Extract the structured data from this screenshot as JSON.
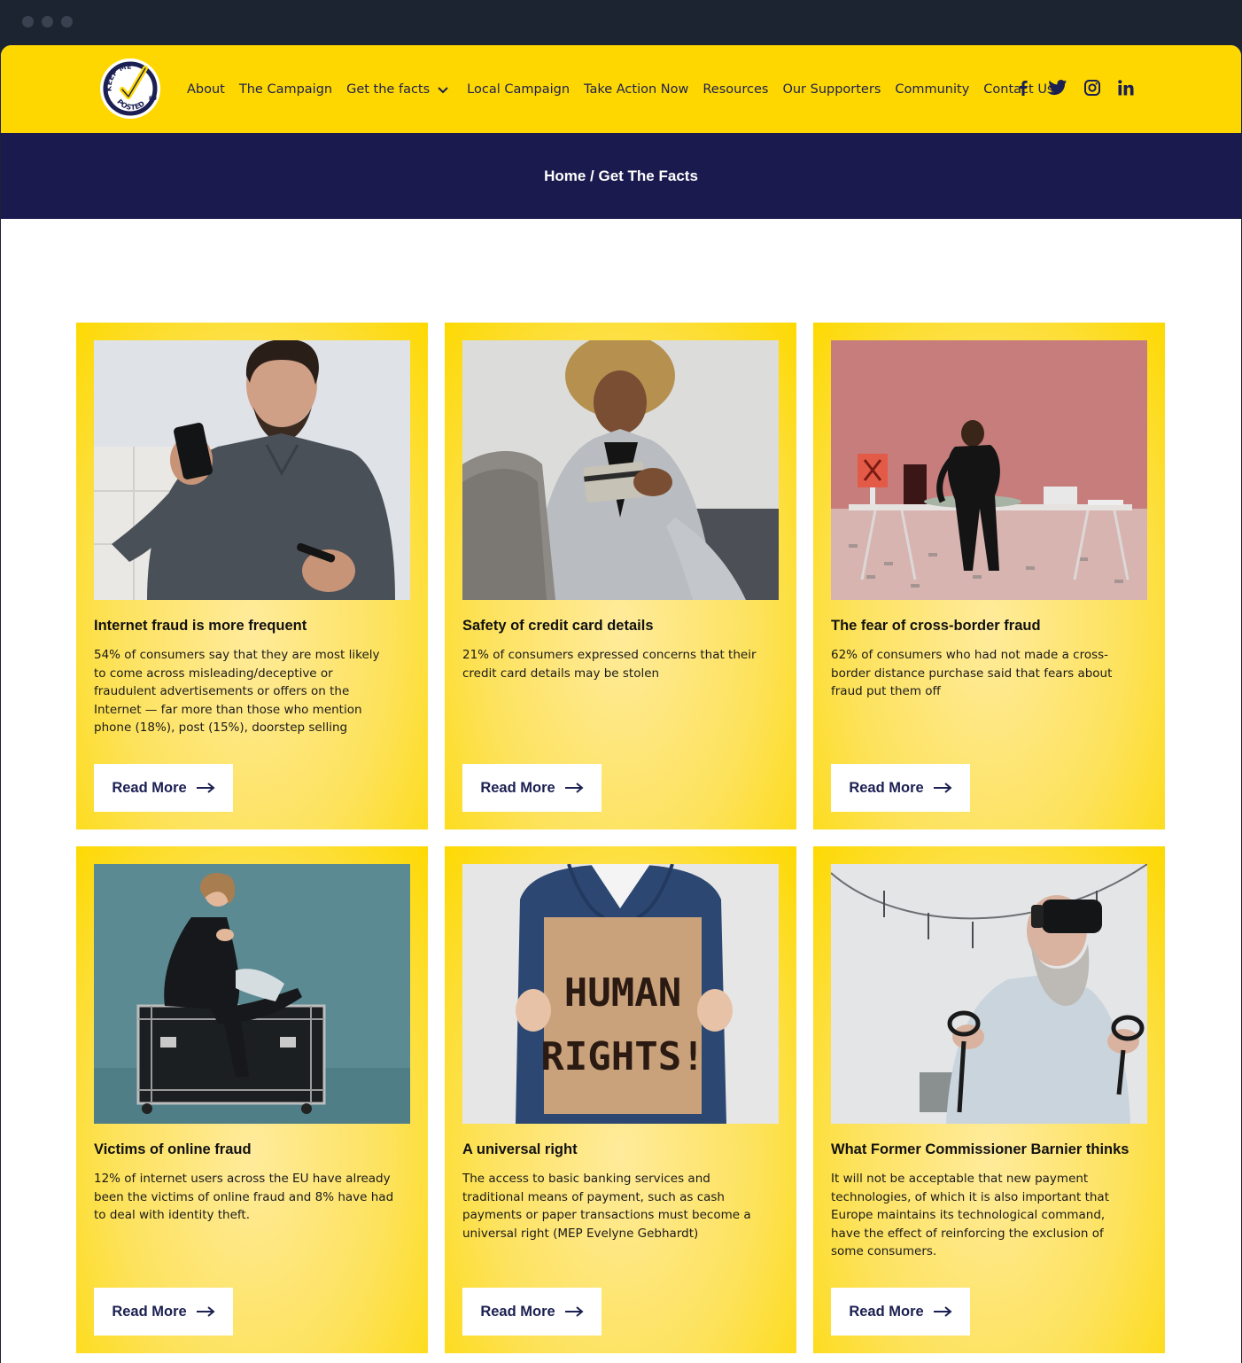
{
  "brand": {
    "logo_text_top": "KEEP ME",
    "logo_text_bottom": "POSTED",
    "logo_text_suffix": "EU",
    "yellow": "#fed700",
    "navy": "#1b1a4f"
  },
  "nav": {
    "items": [
      {
        "label": "About"
      },
      {
        "label": "The Campaign"
      },
      {
        "label": "Get the facts",
        "has_dropdown": true
      },
      {
        "label": "Local Campaign"
      },
      {
        "label": "Take Action Now"
      },
      {
        "label": "Resources"
      },
      {
        "label": "Our Supporters"
      },
      {
        "label": "Community"
      },
      {
        "label": "Contact Us"
      }
    ],
    "social": [
      "facebook-icon",
      "twitter-icon",
      "instagram-icon",
      "linkedin-icon"
    ]
  },
  "breadcrumb": {
    "text": "Home / Get The Facts"
  },
  "cards": [
    {
      "image": "man-with-phone-photo",
      "title": "Internet fraud is more frequent",
      "description": "54% of consumers say that they are most likely to come across misleading/deceptive or fraudulent advertisements or offers on the Internet — far more than those who mention phone (18%), post (15%), doorstep selling",
      "button": "Read More"
    },
    {
      "image": "man-with-credit-card-photo",
      "title": "Safety of credit card details",
      "description": "21% of consumers expressed concerns that their credit card details may be stolen",
      "button": "Read More"
    },
    {
      "image": "man-with-money-table-photo",
      "title": "The fear of cross-border fraud",
      "description": "62% of consumers who had not made a cross-border distance purchase said that fears about fraud put them off",
      "button": "Read More"
    },
    {
      "image": "woman-on-flight-case-photo",
      "title": "Victims of online fraud",
      "description": "12% of internet users across the EU have already been the victims of online fraud and 8% have had to deal with identity theft.",
      "button": "Read More"
    },
    {
      "image": "human-rights-sign-photo",
      "sign_line1": "HUMAN",
      "sign_line2": "RIGHTS!",
      "title": "A universal right",
      "description": "The access to basic banking services and traditional means of payment, such as cash payments or paper transactions must become a universal right (MEP Evelyne Gebhardt)",
      "button": "Read More"
    },
    {
      "image": "man-with-vr-headset-photo",
      "title": "What Former Commissioner Barnier thinks",
      "description": "It will not be acceptable that new payment technologies, of which it is also important that Europe maintains its technological command, have the effect of reinforcing the exclusion of some consumers.",
      "button": "Read More"
    }
  ]
}
